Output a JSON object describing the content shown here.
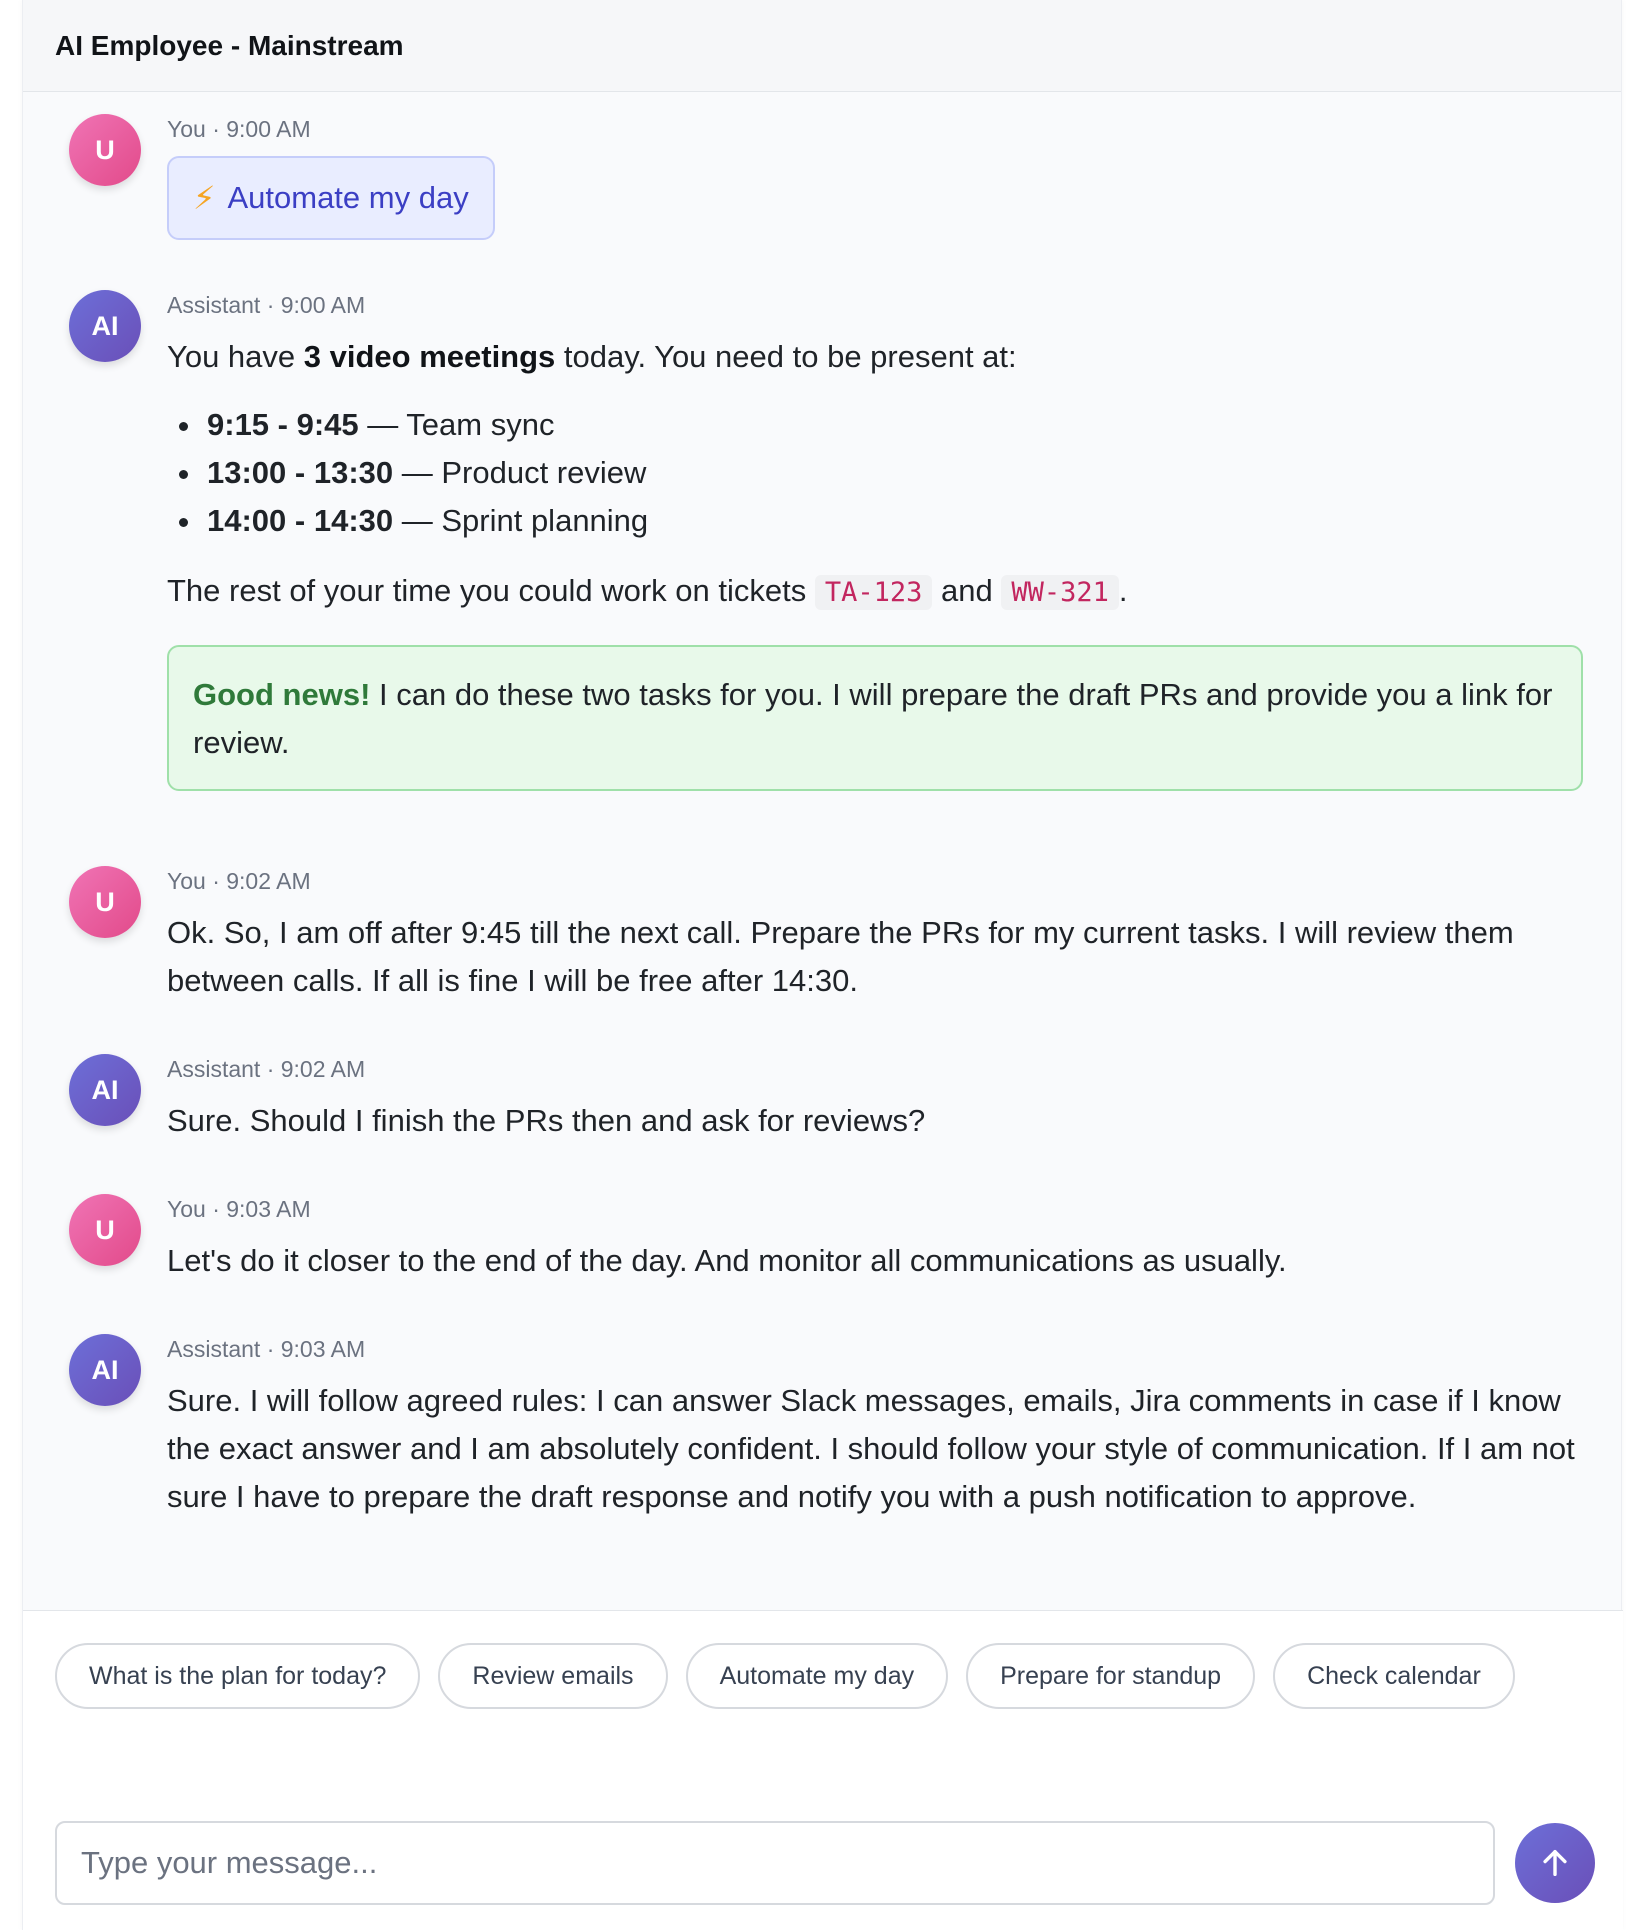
{
  "header": {
    "title": "AI Employee - Mainstream"
  },
  "messages": [
    {
      "avatar": "U",
      "meta": "You · 9:00 AM",
      "chip_icon": "⚡",
      "chip_text": "Automate my day"
    },
    {
      "avatar": "AI",
      "meta": "Assistant · 9:00 AM",
      "intro_pre": "You have ",
      "intro_bold": "3 video meetings",
      "intro_post": " today. You need to be present at:",
      "meetings": [
        {
          "time": "9:15 - 9:45",
          "title": " — Team sync"
        },
        {
          "time": "13:00 - 13:30",
          "title": " — Product review"
        },
        {
          "time": "14:00 - 14:30",
          "title": " — Sprint planning"
        }
      ],
      "rest_pre": "The rest of your time you could work on tickets ",
      "ticket_1": "TA-123",
      "rest_mid": " and ",
      "ticket_2": "WW-321",
      "rest_post": ".",
      "good_strong": "Good news!",
      "good_text": " I can do these two tasks for you. I will prepare the draft PRs and provide you a link for review."
    },
    {
      "avatar": "U",
      "meta": "You · 9:02 AM",
      "text": "Ok. So, I am off after 9:45 till the next call. Prepare the PRs for my current tasks. I will review them between calls. If all is fine I will be free after 14:30."
    },
    {
      "avatar": "AI",
      "meta": "Assistant · 9:02 AM",
      "text": "Sure. Should I finish the PRs then and ask for reviews?"
    },
    {
      "avatar": "U",
      "meta": "You · 9:03 AM",
      "text": "Let's do it closer to the end of the day. And monitor all communications as usually."
    },
    {
      "avatar": "AI",
      "meta": "Assistant · 9:03 AM",
      "text": "Sure. I will follow agreed rules: I can answer Slack messages, emails, Jira comments in case if I know the exact answer and I am absolutely confident. I should follow your style of communication. If I am not sure I have to prepare the draft response and notify you with a push notification to approve."
    }
  ],
  "suggestions": [
    "What is the plan for today?",
    "Review emails",
    "Automate my day",
    "Prepare for standup",
    "Check calendar"
  ],
  "composer": {
    "placeholder": "Type your message...",
    "send_icon": "arrow-up-icon"
  },
  "colors": {
    "user_avatar": "#e24a8a",
    "ai_avatar": "#6a4fb8",
    "chip_bg": "#e9edff",
    "chip_text": "#3b3fc4",
    "good_bg": "#e8f9ea",
    "good_text": "#2f7a3a",
    "code_text": "#c2265f"
  }
}
